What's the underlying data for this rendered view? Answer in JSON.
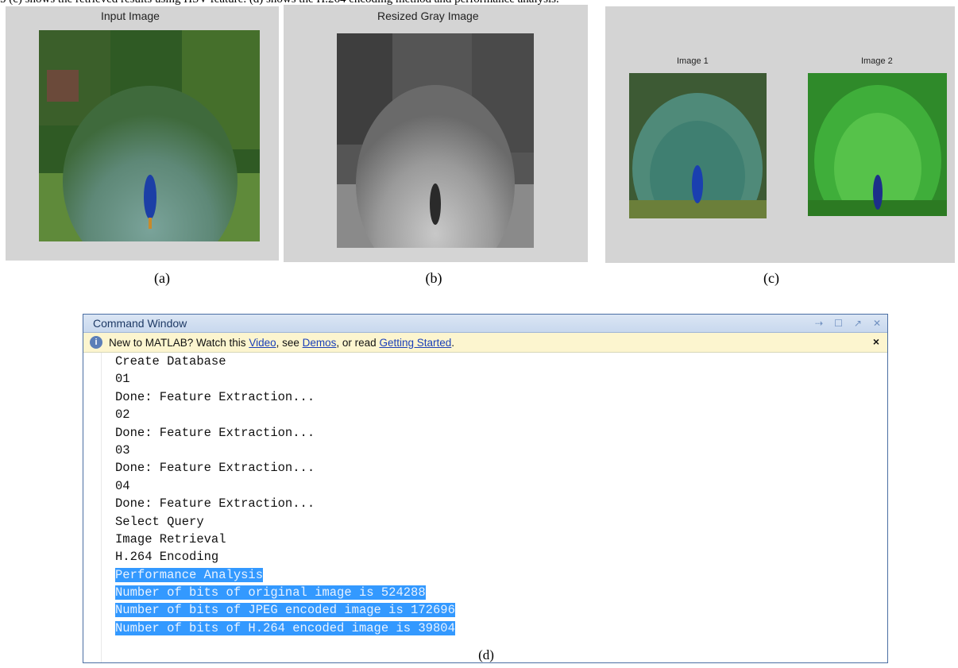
{
  "top_caption": "5 (c) shows the retrieved results using HSV feature. (d) shows the H.264 encoding method and performance analysis.",
  "panels": {
    "a": {
      "title": "Input Image",
      "caption": "(a)"
    },
    "b": {
      "title": "Resized Gray Image",
      "caption": "(b)"
    },
    "c": {
      "title_1": "Image 1",
      "title_2": "Image 2",
      "caption": "(c)"
    }
  },
  "command_window": {
    "title": "Command Window",
    "info_bar": {
      "prefix": "New to MATLAB? Watch this ",
      "link_video": "Video",
      "sep1": ", see ",
      "link_demos": "Demos",
      "sep2": ", or read ",
      "link_getting_started": "Getting Started",
      "suffix": ".",
      "close": "×"
    },
    "lines": [
      "Create Database",
      "01",
      "Done: Feature Extraction...",
      "02",
      "Done: Feature Extraction...",
      "03",
      "Done: Feature Extraction...",
      "04",
      "Done: Feature Extraction...",
      "Select Query",
      "Image Retrieval",
      "H.264 Encoding"
    ],
    "selected_lines": [
      "Performance Analysis",
      "Number of bits of original image is 524288",
      "Number of bits of JPEG encoded image is 172696",
      "Number of bits of H.264 encoded image is 39804"
    ],
    "caption": "(d)"
  },
  "colors": {
    "panel_bg": "#d4d4d4",
    "selection": "#3399ff",
    "info_bar": "#fcf5cf",
    "link": "#1a3fb8"
  }
}
